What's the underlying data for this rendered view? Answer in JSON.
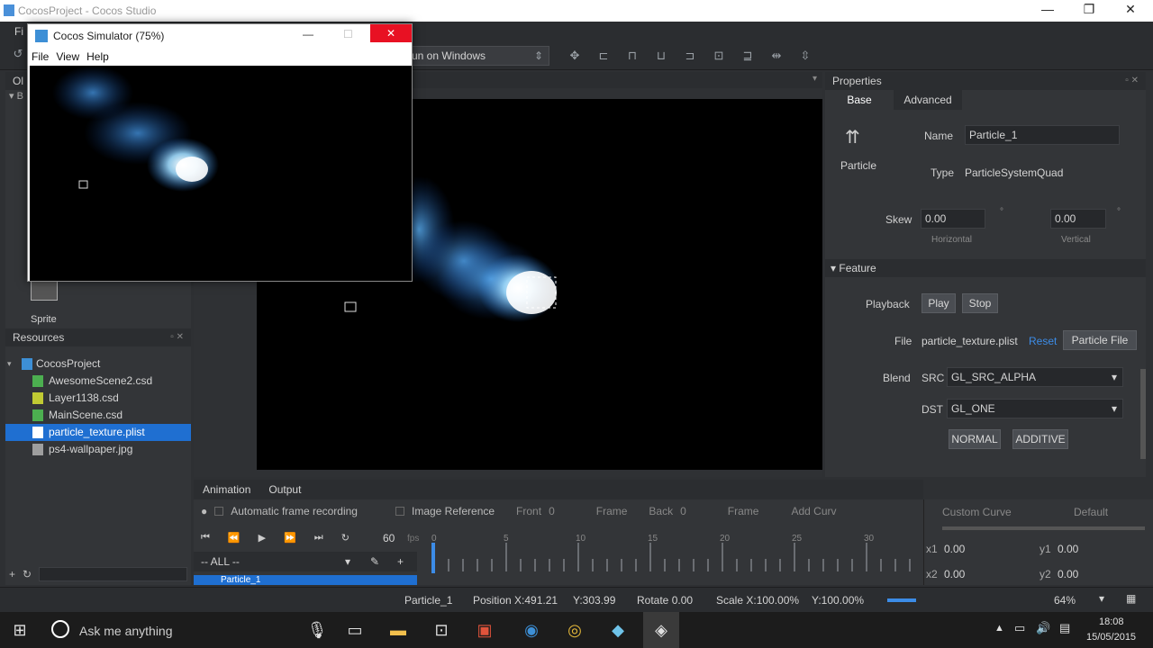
{
  "window": {
    "title": "CocosProject - Cocos Studio",
    "minimize": "—",
    "restore": "❐",
    "close": "✕"
  },
  "menubar": {
    "first": "Fi"
  },
  "toolbar": {
    "run_target": "un on Windows"
  },
  "objects": {
    "head": "Ol",
    "collapsed_marker": "B",
    "sprite_label": "Sprite"
  },
  "resources": {
    "title": "Resources",
    "project": "CocosProject",
    "files": [
      {
        "name": "AwesomeScene2.csd",
        "color": "#4caf50"
      },
      {
        "name": "Layer1138.csd",
        "color": "#c0ca33"
      },
      {
        "name": "MainScene.csd",
        "color": "#4caf50"
      },
      {
        "name": "particle_texture.plist",
        "color": "#ffffff",
        "selected": true
      },
      {
        "name": "ps4-wallpaper.jpg",
        "color": "#9e9e9e"
      }
    ]
  },
  "properties": {
    "title": "Properties",
    "tab_base": "Base",
    "tab_advanced": "Advanced",
    "node_type_label": "Particle",
    "name_label": "Name",
    "name_value": "Particle_1",
    "type_label": "Type",
    "type_value": "ParticleSystemQuad",
    "skew_label": "Skew",
    "skew_h": "0.00",
    "skew_v": "0.00",
    "deg": "°",
    "horizontal": "Horizontal",
    "vertical": "Vertical",
    "feature": "Feature",
    "playback_label": "Playback",
    "play": "Play",
    "stop": "Stop",
    "file_label": "File",
    "file_value": "particle_texture.plist",
    "reset": "Reset",
    "particle_file": "Particle File",
    "blend_label": "Blend",
    "src_label": "SRC",
    "src_value": "GL_SRC_ALPHA",
    "dst_label": "DST",
    "dst_value": "GL_ONE",
    "normal": "NORMAL",
    "additive": "ADDITIVE"
  },
  "animation": {
    "tab_animation": "Animation",
    "tab_output": "Output",
    "auto_record": "Automatic frame recording",
    "image_ref": "Image Reference",
    "front": "Front",
    "front_val": "0",
    "frame1": "Frame",
    "back": "Back",
    "back_val": "0",
    "frame2": "Frame",
    "add_curve": "Add Curv",
    "fps": "60",
    "fps_unit": "fps",
    "filter": "-- ALL --",
    "track": "Particle_1",
    "ticks": [
      "0",
      "5",
      "10",
      "15",
      "20",
      "25",
      "30"
    ]
  },
  "curve": {
    "custom": "Custom Curve",
    "default": "Default",
    "x1": "x1",
    "x1v": "0.00",
    "y1": "y1",
    "y1v": "0.00",
    "x2": "x2",
    "x2v": "0.00",
    "y2": "y2",
    "y2v": "0.00"
  },
  "status": {
    "node": "Particle_1",
    "position": "Position X:491.21",
    "pos_y": "Y:303.99",
    "rotate": "Rotate 0.00",
    "scale": "Scale X:100.00%",
    "scale_y": "Y:100.00%",
    "zoom": "64%"
  },
  "simulator": {
    "title": "Cocos Simulator (75%)",
    "menu": [
      "File",
      "View",
      "Help"
    ]
  },
  "taskbar": {
    "search": "Ask me anything",
    "time": "18:08",
    "date": "15/05/2015"
  }
}
